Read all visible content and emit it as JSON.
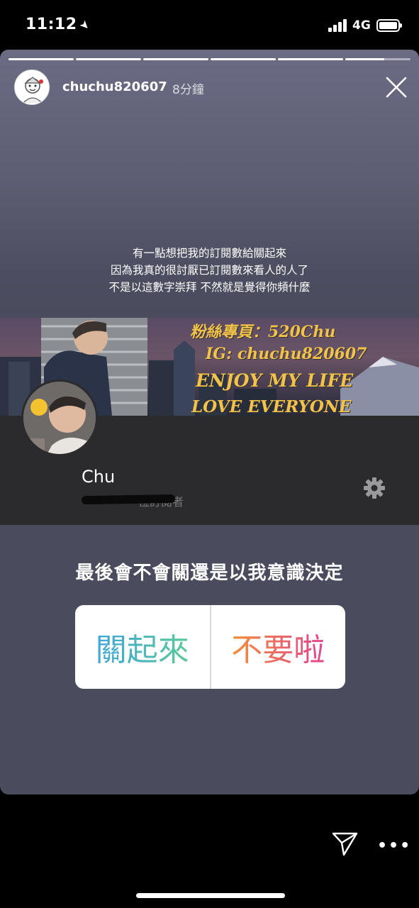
{
  "status_bar": {
    "time": "11:12",
    "location_icon": "location-arrow-icon",
    "network": "4G",
    "battery_level": 1.0
  },
  "story": {
    "progress_segments": 6,
    "progress_complete": 5,
    "progress_current_fraction": 0.6,
    "username": "chuchu820607",
    "time_ago": "8分鐘",
    "close_icon": "close-icon",
    "caption_lines": [
      "有一點想把我的訂閱數給關起來",
      "因為我真的很討厭已訂閱數來看人的人了",
      "不是以這數字崇拜 不然就是覺得你頻什麼"
    ]
  },
  "profile_screenshot": {
    "cover_lines": [
      "粉絲專頁：520Chu",
      "IG: chuchu820607",
      "ENJOY MY LIFE",
      "LOVE EVERYONE"
    ],
    "name": "Chu",
    "subscribers_visible": "位訂閱者",
    "gear_icon": "gear-icon"
  },
  "poll": {
    "question": "最後會不會關還是以我意識決定",
    "option_a": "關起來",
    "option_b": "不要啦"
  },
  "bottom_bar": {
    "send_icon": "send-icon",
    "more_label": "•••"
  },
  "colors": {
    "background": "#000000",
    "story_top": "#6b6c84",
    "panel": "#2b2b2d",
    "cover_text": "#f3c24a"
  }
}
